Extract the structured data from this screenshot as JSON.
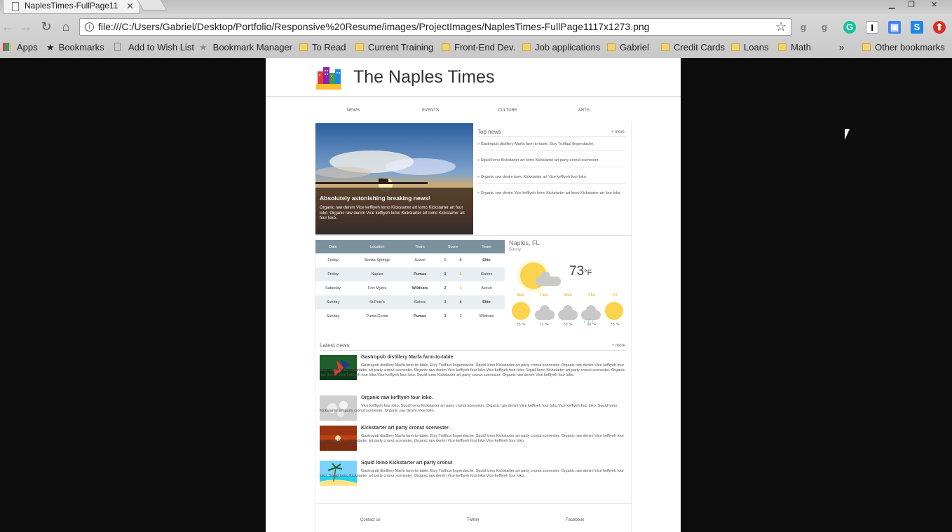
{
  "browser": {
    "tab_title": "NaplesTimes-FullPage11",
    "url": "file:///C:/Users/Gabriel/Desktop/Portfolio/Responsive%20Resume/images/ProjectImages/NaplesTimes-FullPage1117x1273.png",
    "bookmarks": [
      "Apps",
      "Bookmarks",
      "Add to Wish List",
      "Bookmark Manager",
      "To Read",
      "Current Training",
      "Front-End Dev.",
      "Job applications",
      "Gabriel",
      "Credit Cards",
      "Loans",
      "Math"
    ],
    "overflow_label": "»",
    "other_bookmarks": "Other bookmarks"
  },
  "site": {
    "title": "The Naples Times",
    "nav": [
      "NEWS",
      "EVENTS",
      "CULTURE",
      "ARTS"
    ]
  },
  "hero": {
    "headline": "Absolutely astonishing breaking news!",
    "summary": "Organic raw denim Vice keffiyeh lomo Kickstarter art lomo Kickstarter art four loko. Organic raw denim Vice keffiyeh lomo Kickstarter art lomo Kickstarter art four loko."
  },
  "top_news": {
    "title": "Top news",
    "more": "+ more",
    "items": [
      "» Gastropub distillery Marfa farm-to-table. Etsy Truffaut fingerstache.",
      "» Squid lomo Kickstarter art lomo Kickstarter art party cronut scenester.",
      "» Organic raw denim lomo Kickstarter art Vice keffiyeh four loko.",
      "» Organic raw denim Vice keffiyeh lomo Kickstarter art lomo Kickstarter art four loko."
    ]
  },
  "scores": {
    "headers": [
      "Date",
      "Location",
      "Team",
      "Score",
      "Team"
    ],
    "rows": [
      {
        "date": "Friday",
        "location": "Bonita Springs",
        "team1": "Azzuri",
        "s1": "0",
        "s2": "4",
        "team2": "Elite"
      },
      {
        "date": "Friday",
        "location": "Naples",
        "team1": "Pumas",
        "s1": "3",
        "s2": "1",
        "team2": "Gators"
      },
      {
        "date": "Saturday",
        "location": "Fort Myers",
        "team1": "Wildcats",
        "s1": "2",
        "s2": "1",
        "team2": "Azzuri"
      },
      {
        "date": "Sunday",
        "location": "St.Pete's",
        "team1": "Gators",
        "s1": "3",
        "s2": "4",
        "team2": "Elite"
      },
      {
        "date": "Sunday",
        "location": "Punta Gorda",
        "team1": "Pumas",
        "s1": "3",
        "s2": "2",
        "team2": "Wildcats"
      }
    ]
  },
  "weather": {
    "city": "Naples, FL",
    "condition": "Sunny",
    "temp": "73",
    "unit": "°F",
    "forecast": [
      {
        "day": "Mon",
        "temp": "75 °F",
        "icon": "sun-icon"
      },
      {
        "day": "Tues",
        "temp": "71 °F",
        "icon": "cloud-icon"
      },
      {
        "day": "Wed",
        "temp": "70 °F",
        "icon": "cloud-icon"
      },
      {
        "day": "Thu",
        "temp": "69 °F",
        "icon": "rain-icon"
      },
      {
        "day": "Fri",
        "temp": "75 °F",
        "icon": "sun-icon"
      }
    ],
    "day_color": "#f59e0b",
    "temp_color": "#777777"
  },
  "latest_news": {
    "title": "Latest news",
    "more": "+ more",
    "articles": [
      {
        "title": "Gastropub distillery Marfa farm-to-table",
        "text": "Gastropub distillery Marfa farm-to-table, Etsy Truffaut fingerstache. Squid lomo Kickstarter art party cronut scenester. Organic raw denim Vice keffiyeh four loko. Squid lomo Kickstarter art party cronut scenester. Organic raw denim Vice keffiyeh four loko.Vice keffiyeh four loko. Squid lomo Kickstarter art party cronut scenester. Organic raw denim Vice keffiyeh four loko.Vice keffiyeh four loko. Squid lomo Kickstarter art party cronut scenester. Organic raw denim Vice keffiyeh four loko."
      },
      {
        "title": "Organic raw keffiyeh four loko.",
        "text": "Vice keffiyeh four loko. Squid lomo Kickstarter art party cronut scenester. Organic raw denim Vice keffiyeh four loko.Vice keffiyeh four loko. Squid lomo Kickstarter art party cronut scenester. Organic raw denim Vice loko."
      },
      {
        "title": "Kickstarter art party cronut scenester.",
        "text": "Gastropub distillery Marfa farm-to-table, Etsy Truffaut fingerstache. Squid lomo Kickstarter art party cronut scenester. Organic raw denim Vice keffiyeh four loko. Squid lomo Kickstarter art party cronut scenester. Organic raw denim Vice keffiyeh four loko.Vice keffiyeh four loko."
      },
      {
        "title": "Squid lomo Kickstarter art party cronut",
        "text": "Gastropub distillery Marfa farm-to-table, Etsy Truffaut fingerstache. Squid lomo Kickstarter art party cronut scenester. Organic raw denim Vice keffiyeh four loko. Squid lomo Kickstarter art party cronut scenester. Organic raw denim Vice keffiyeh four loko.Vice keffiyeh four loko."
      }
    ]
  },
  "footer": {
    "links": [
      "Contact us",
      "Twitter",
      "Facebook"
    ]
  }
}
